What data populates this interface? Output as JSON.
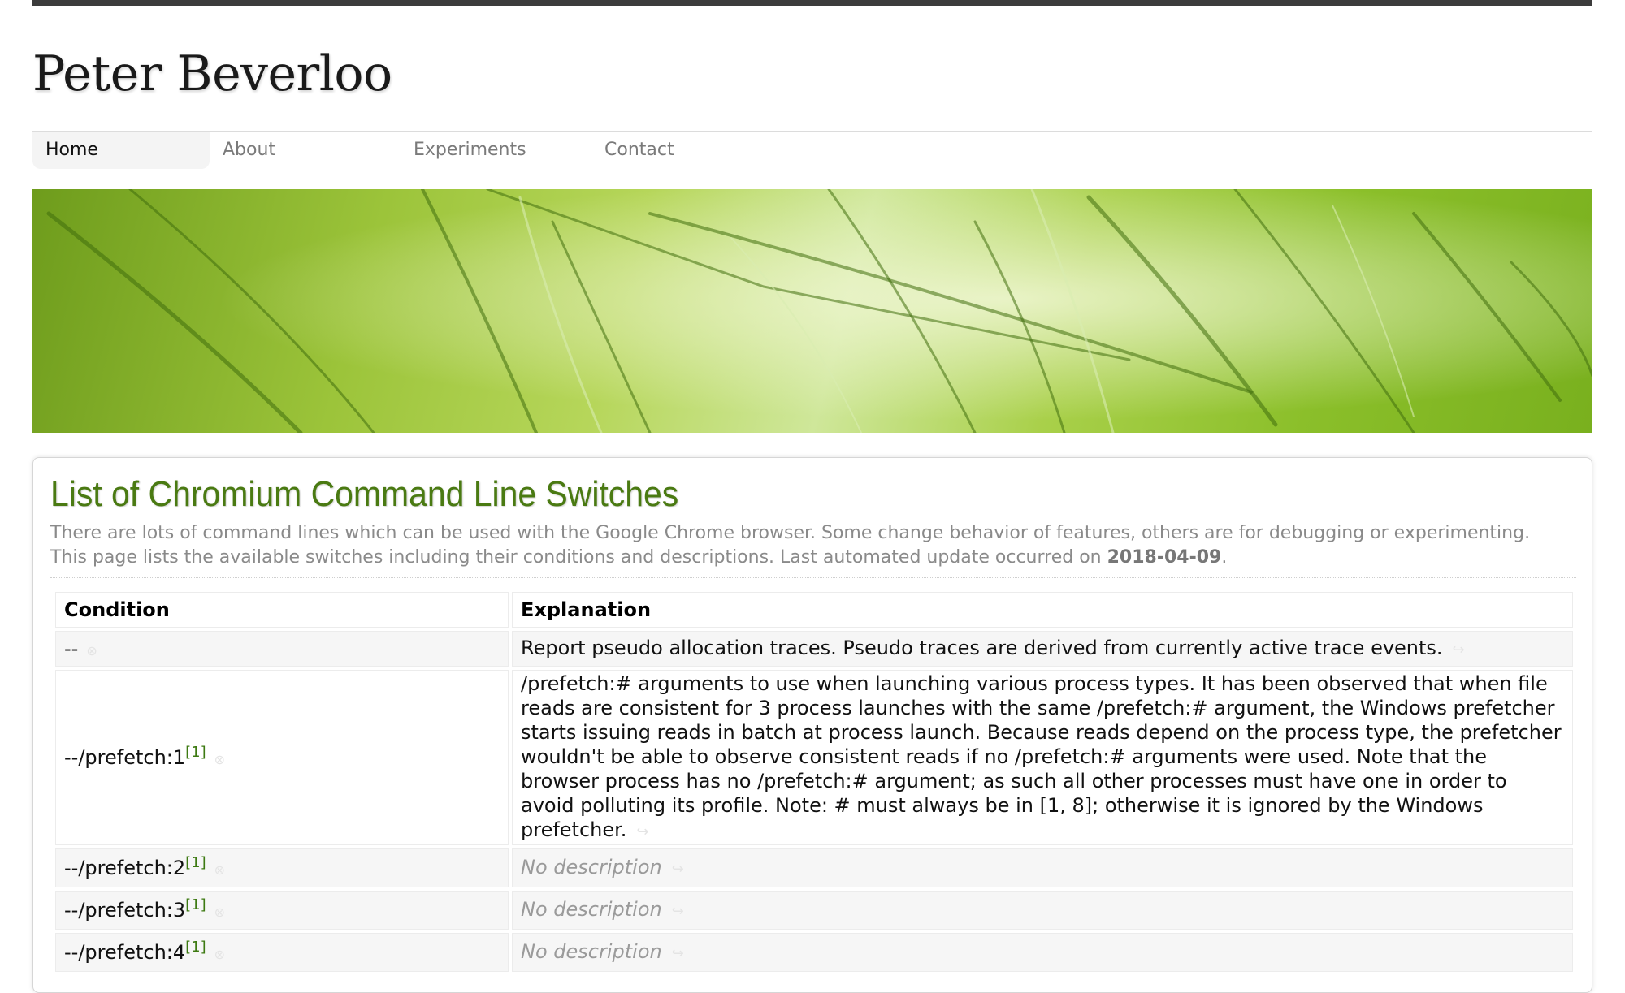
{
  "site": {
    "title": "Peter Beverloo"
  },
  "nav": {
    "items": [
      "Home",
      "About",
      "Experiments",
      "Contact"
    ],
    "active": "Home"
  },
  "article": {
    "title": "List of Chromium Command Line Switches",
    "intro_line1": "There are lots of command lines which can be used with the Google Chrome browser. Some change behavior of features, others are for debugging or experimenting.",
    "intro_line2": "This page lists the available switches including their conditions and descriptions. Last automated update occurred on",
    "update_date": "2018-04-09",
    "intro_end": "."
  },
  "table": {
    "headers": {
      "condition": "Condition",
      "explanation": "Explanation"
    },
    "rows": [
      {
        "switch": "--",
        "ref": "",
        "explanation": "Report pseudo allocation traces. Pseudo traces are derived from currently active trace events."
      },
      {
        "switch": "--/prefetch:1",
        "ref": "[1]",
        "explanation": "/prefetch:# arguments to use when launching various process types. It has been observed that when file reads are consistent for 3 process launches with the same /prefetch:# argument, the Windows prefetcher starts issuing reads in batch at process launch. Because reads depend on the process type, the prefetcher wouldn't be able to observe consistent reads if no /prefetch:# arguments were used. Note that the browser process has no /prefetch:# argument; as such all other processes must have one in order to avoid polluting its profile. Note: # must always be in [1, 8]; otherwise it is ignored by the Windows prefetcher."
      },
      {
        "switch": "--/prefetch:2",
        "ref": "[1]",
        "explanation": "No description"
      },
      {
        "switch": "--/prefetch:3",
        "ref": "[1]",
        "explanation": "No description"
      },
      {
        "switch": "--/prefetch:4",
        "ref": "[1]",
        "explanation": "No description"
      }
    ]
  },
  "icons": {
    "permalink": "link-icon",
    "return": "return-icon"
  },
  "colors": {
    "accent": "#4a7a12",
    "topbar": "#3c3c3c"
  }
}
